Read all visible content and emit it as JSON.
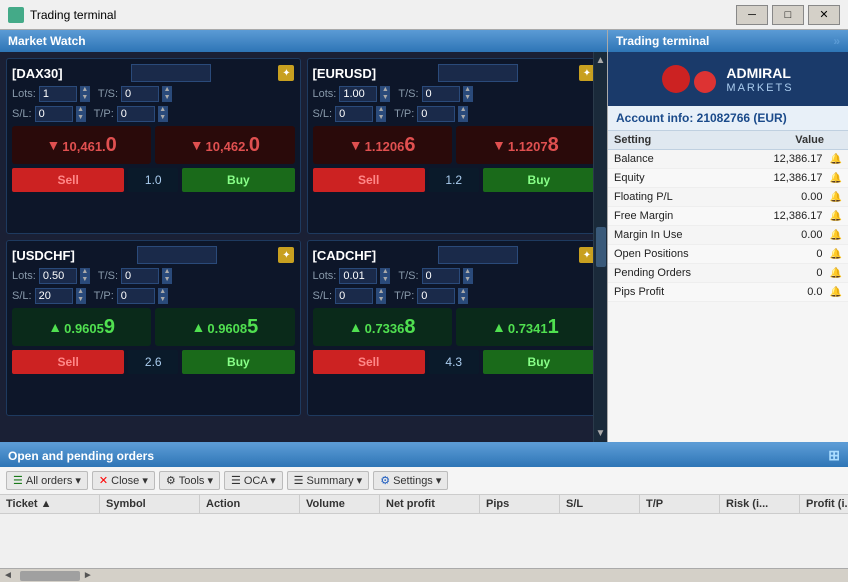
{
  "window": {
    "title": "Trading terminal",
    "minimize": "─",
    "maximize": "□",
    "close": "✕"
  },
  "market_watch": {
    "title": "Market Watch",
    "instruments": [
      {
        "name": "DAX30",
        "lots_label": "Lots:",
        "lots_value": "1",
        "ts_label": "T/S:",
        "ts_value": "0",
        "sl_label": "S/L:",
        "sl_value": "0",
        "tp_label": "T/P:",
        "tp_value": "0",
        "sell_price_prefix": "10,461.",
        "sell_price_big": "0",
        "sell_arrow": "▼",
        "buy_price_prefix": "10,462.",
        "buy_price_big": "0",
        "buy_arrow": "▼",
        "sell_label": "Sell",
        "buy_label": "Buy",
        "spread": "1.0"
      },
      {
        "name": "EURUSD",
        "lots_label": "Lots:",
        "lots_value": "1.00",
        "ts_label": "T/S:",
        "ts_value": "0",
        "sl_label": "S/L:",
        "sl_value": "0",
        "tp_label": "T/P:",
        "tp_value": "0",
        "sell_price_prefix": "1.1206",
        "sell_price_big": "6",
        "sell_arrow": "▼",
        "buy_price_prefix": "1.1207",
        "buy_price_big": "8",
        "buy_arrow": "▼",
        "sell_label": "Sell",
        "buy_label": "Buy",
        "spread": "1.2"
      },
      {
        "name": "USDCHF",
        "lots_label": "Lots:",
        "lots_value": "0.50",
        "ts_label": "T/S:",
        "ts_value": "0",
        "sl_label": "S/L:",
        "sl_value": "20",
        "tp_label": "T/P:",
        "tp_value": "0",
        "sell_price_prefix": "0.9605",
        "sell_price_big": "9",
        "sell_arrow": "▲",
        "buy_price_prefix": "0.9608",
        "buy_price_big": "5",
        "buy_arrow": "▲",
        "sell_label": "Sell",
        "buy_label": "Buy",
        "spread": "2.6"
      },
      {
        "name": "CADCHF",
        "lots_label": "Lots:",
        "lots_value": "0.01",
        "ts_label": "T/S:",
        "ts_value": "0",
        "sl_label": "S/L:",
        "sl_value": "0",
        "tp_label": "T/P:",
        "tp_value": "0",
        "sell_price_prefix": "0.7336",
        "sell_price_big": "8",
        "sell_arrow": "▲",
        "buy_price_prefix": "0.7341",
        "buy_price_big": "1",
        "buy_arrow": "▲",
        "sell_label": "Sell",
        "buy_label": "Buy",
        "spread": "4.3"
      }
    ]
  },
  "trading_terminal": {
    "title": "Trading terminal",
    "account_info": "Account info: 21082766 (EUR)",
    "admiral_text1": "ADMIRAL",
    "admiral_text2": "MARKETS",
    "table_headers": {
      "setting": "Setting",
      "value": "Value"
    },
    "rows": [
      {
        "setting": "Balance",
        "value": "12,386.17"
      },
      {
        "setting": "Equity",
        "value": "12,386.17"
      },
      {
        "setting": "Floating P/L",
        "value": "0.00"
      },
      {
        "setting": "Free Margin",
        "value": "12,386.17"
      },
      {
        "setting": "Margin In Use",
        "value": "0.00"
      },
      {
        "setting": "Open Positions",
        "value": "0"
      },
      {
        "setting": "Pending Orders",
        "value": "0"
      },
      {
        "setting": "Pips Profit",
        "value": "0.0"
      }
    ]
  },
  "bottom_panel": {
    "title": "Open and pending orders",
    "toolbar": {
      "all_orders": "All orders ▾",
      "close": "✕ Close ▾",
      "tools": "⚙ Tools ▾",
      "oca": "☰ OCA ▾",
      "summary": "☰ Summary ▾",
      "settings": "⚙ Settings ▾"
    },
    "columns": [
      "Ticket ▲",
      "Symbol",
      "Action",
      "Volume",
      "Net profit",
      "Pips",
      "S/L",
      "T/P",
      "Risk (i...",
      "Profit (i..."
    ]
  }
}
